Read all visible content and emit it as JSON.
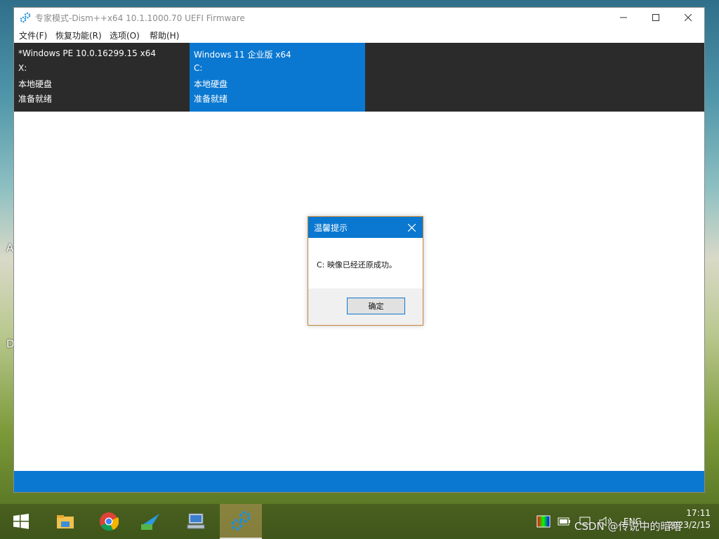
{
  "desktop": {
    "letters": [
      "A",
      "D"
    ]
  },
  "window": {
    "title": "专家模式-Dism++x64 10.1.1000.70 UEFI Firmware",
    "menu": [
      "文件(F)",
      "恢复功能(R)",
      "选项(O)",
      "帮助(H)"
    ],
    "sessions": [
      {
        "name": "*Windows PE 10.0.16299.15 x64",
        "drive": "X:",
        "disk": "本地硬盘",
        "status": "准备就绪"
      },
      {
        "name": "Windows 11 企业版 x64",
        "drive": "C:",
        "disk": "本地硬盘",
        "status": "准备就绪"
      }
    ]
  },
  "dialog": {
    "title": "温馨提示",
    "message": "C: 映像已经还原成功。",
    "ok_label": "确定"
  },
  "taskbar": {
    "apps": [
      "start-icon",
      "file-explorer-icon",
      "chrome-icon",
      "lite-app-icon",
      "computer-icon",
      "dism-gear-icon"
    ],
    "lang": "ENG",
    "time": "17:11",
    "date": "2023/2/15"
  },
  "watermark": "CSDN @传说中的暗暗",
  "colors": {
    "accent": "#0a78d1",
    "session_bg": "#2b2b2b"
  }
}
